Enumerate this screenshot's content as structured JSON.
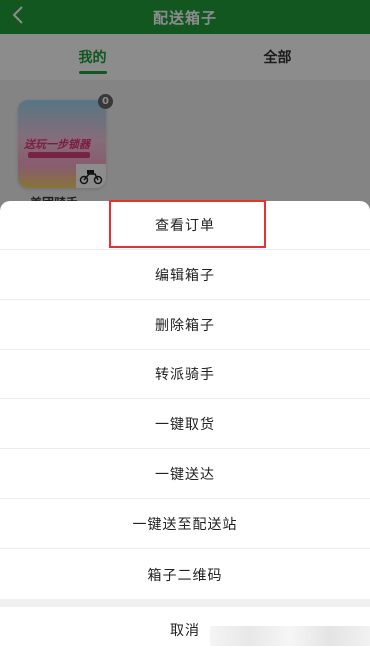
{
  "header": {
    "title": "配送箱子",
    "back_icon": "chevron-left-icon"
  },
  "tabs": [
    {
      "label": "我的",
      "active": true
    },
    {
      "label": "全部",
      "active": false
    }
  ],
  "box": {
    "badge_count": "0",
    "banner_text": "送玩一步锁器",
    "label": "美团骑手",
    "scooter_icon": "scooter-icon"
  },
  "action_sheet": {
    "items": [
      {
        "label": "查看订单"
      },
      {
        "label": "编辑箱子"
      },
      {
        "label": "删除箱子"
      },
      {
        "label": "转派骑手"
      },
      {
        "label": "一键取货"
      },
      {
        "label": "一键送达"
      },
      {
        "label": "一键送至配送站"
      },
      {
        "label": "箱子二维码"
      }
    ],
    "cancel_label": "取消"
  },
  "colors": {
    "brand_green": "#1f9e3a",
    "highlight_red": "#e8312f"
  }
}
